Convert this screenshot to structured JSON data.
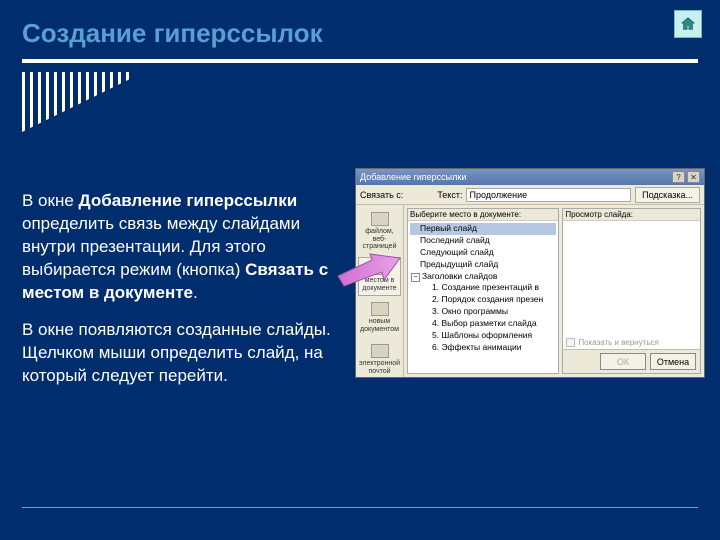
{
  "slide": {
    "title": "Создание гиперссылок",
    "paragraph1_prefix": "В окне ",
    "paragraph1_bold1": "Добавление гиперссылки",
    "paragraph1_mid": " определить связь между слайдами внутри презентации. Для этого выбирается режим (кнопка) ",
    "paragraph1_bold2": "Связать с местом в документе",
    "paragraph1_suffix": ".",
    "paragraph2": "В окне появляются созданные слайды. Щелчком мыши определить слайд, на который следует перейти."
  },
  "dialog": {
    "title": "Добавление гиперссылки",
    "link_with_label": "Связать с:",
    "text_label": "Текст:",
    "text_value": "Продолжение",
    "tooltip_button": "Подсказка...",
    "tree_label": "Выберите место в документе:",
    "preview_label": "Просмотр слайда:",
    "show_and_return": "Показать и вернуться",
    "ok": "ОК",
    "cancel": "Отмена",
    "sidebar": [
      {
        "label": "файлом, веб-страницей"
      },
      {
        "label": "местом в документе"
      },
      {
        "label": "новым документом"
      },
      {
        "label": "электронной почтой"
      }
    ],
    "tree": {
      "top": [
        "Первый слайд",
        "Последний слайд",
        "Следующий слайд",
        "Предыдущий слайд"
      ],
      "group": "Заголовки слайдов",
      "children": [
        "1. Создание презентаций в",
        "2. Порядок создания презен",
        "3. Окно программы",
        "4. Выбор разметки слайда",
        "5. Шаблоны оформления",
        "6. Эффекты анимации"
      ]
    }
  }
}
